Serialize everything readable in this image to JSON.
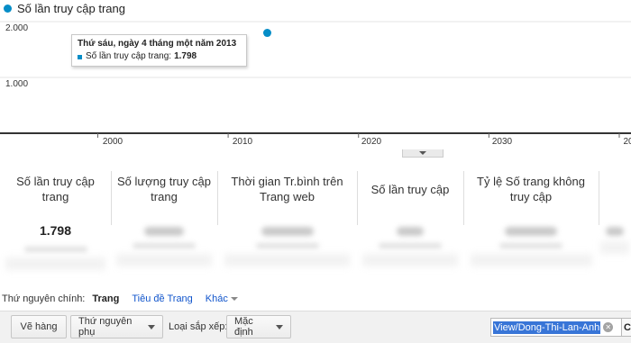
{
  "legend": {
    "label": "Số lần truy cập trang",
    "color": "#058dc7"
  },
  "chart_data": {
    "type": "scatter",
    "title": "",
    "series": [
      {
        "name": "Số lần truy cập trang",
        "points": [
          {
            "x": 2013,
            "y": 1798
          }
        ]
      }
    ],
    "y_ticks": [
      "1.000",
      "2.000"
    ],
    "x_ticks": [
      "2000",
      "2010",
      "2020",
      "2030",
      "20"
    ],
    "xlim": [
      1992.5,
      2040.9
    ],
    "ylim": [
      0,
      2000
    ],
    "grid": true
  },
  "tooltip": {
    "date": "Thứ sáu, ngày 4 tháng một năm 2013",
    "metric_label": "Số lần truy cập trang:",
    "metric_value": "1.798"
  },
  "metrics": [
    {
      "label": "Số lần truy cập trang",
      "value": "1.798"
    },
    {
      "label": "Số lượng truy cập trang",
      "value": ""
    },
    {
      "label": "Thời gian Tr.bình trên Trang web",
      "value": ""
    },
    {
      "label": "Số lần truy cập",
      "value": ""
    },
    {
      "label": "Tỷ lệ Số trang không truy cập",
      "value": ""
    }
  ],
  "dimension": {
    "label": "Thứ nguyên chính:",
    "active": "Trang",
    "link": "Tiêu đề Trang",
    "more": "Khác"
  },
  "toolbar": {
    "plot_rows": "Vẽ hàng",
    "secondary_dimension": "Thứ nguyên phụ",
    "sort_label": "Loại sắp xếp:",
    "sort_value": "Mặc định",
    "search_value": "View/Dong-Thi-Lan-Anh",
    "go_label": "C"
  }
}
